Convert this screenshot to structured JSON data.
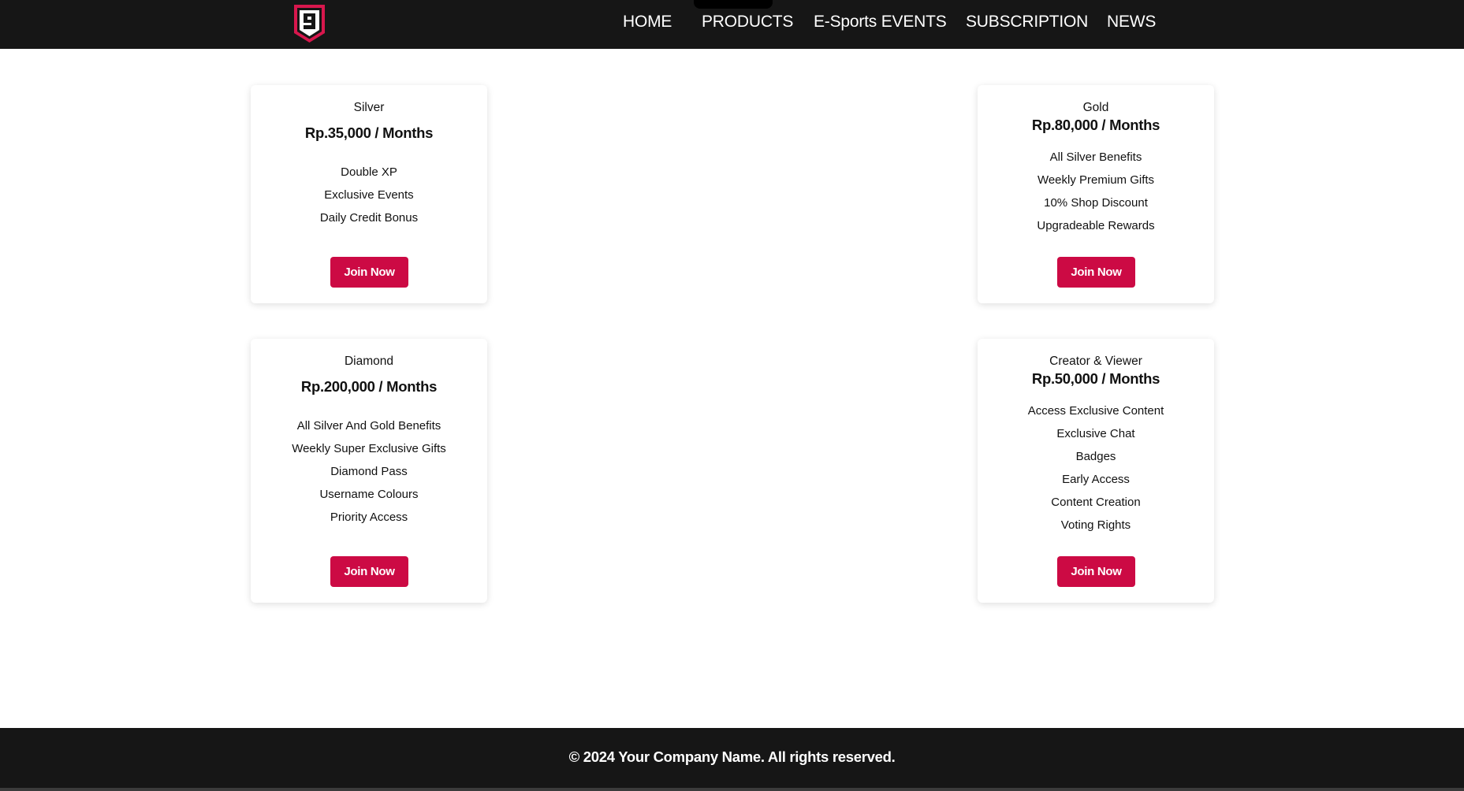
{
  "nav": {
    "items": [
      {
        "label": "HOME"
      },
      {
        "label": "PRODUCTS"
      },
      {
        "label": "E-Sports EVENTS"
      },
      {
        "label": "SUBSCRIPTION"
      },
      {
        "label": "NEWS"
      }
    ],
    "logo_icon": "shield-number-9-logo",
    "logo_text": "9"
  },
  "plans": [
    {
      "name": "Silver",
      "price": "Rp.35,000 / Months",
      "features": [
        "Double XP",
        "Exclusive Events",
        "Daily Credit Bonus"
      ],
      "button": "Join Now"
    },
    {
      "name": "Gold",
      "price": "Rp.80,000 / Months",
      "features": [
        "All Silver Benefits",
        "Weekly Premium Gifts",
        "10% Shop Discount",
        "Upgradeable Rewards"
      ],
      "button": "Join Now"
    },
    {
      "name": "Diamond",
      "price": "Rp.200,000 / Months",
      "features": [
        "All Silver And Gold Benefits",
        "Weekly Super Exclusive Gifts",
        "Diamond Pass",
        "Username Colours",
        "Priority Access"
      ],
      "button": "Join Now"
    },
    {
      "name": "Creator & Viewer",
      "price": "Rp.50,000 / Months",
      "features": [
        "Access Exclusive Content",
        "Exclusive Chat",
        "Badges",
        "Early Access",
        "Content Creation",
        "Voting Rights"
      ],
      "button": "Join Now"
    }
  ],
  "footer": {
    "text": "© 2024 Your Company Name. All rights reserved."
  },
  "colors": {
    "header_bg": "#161616",
    "accent": "#cc0a44",
    "page_bg": "#ffffff"
  }
}
